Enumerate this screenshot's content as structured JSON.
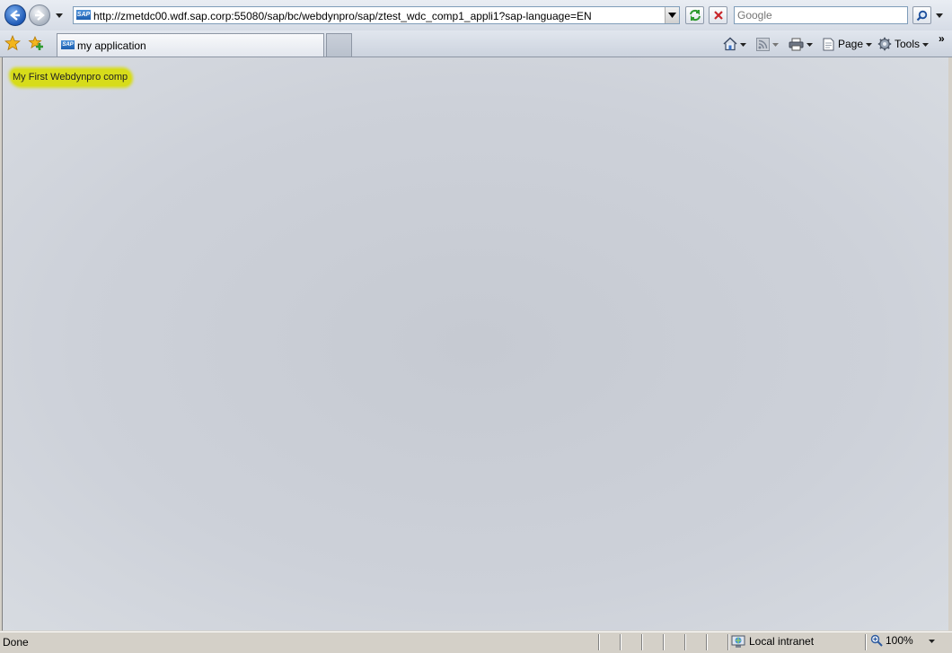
{
  "browser": {
    "address": {
      "favicon_text": "SAP",
      "url": "http://zmetdc00.wdf.sap.corp:55080/sap/bc/webdynpro/sap/ztest_wdc_comp1_appli1?sap-language=EN"
    },
    "search": {
      "placeholder": "Google"
    },
    "tab": {
      "favicon_text": "SAP",
      "title": "my application"
    },
    "commands": {
      "page_label": "Page",
      "tools_label": "Tools"
    },
    "more_chevron": "»"
  },
  "page": {
    "component_text": "My First Webdynpro comp",
    "highlight_color": "#d7dc1a"
  },
  "status_bar": {
    "status": "Done",
    "zone": "Local intranet",
    "zoom": "100%"
  },
  "icons": [
    "back-icon",
    "forward-icon",
    "refresh-icon",
    "stop-icon",
    "search-icon",
    "favorites-star-icon",
    "add-favorites-icon",
    "home-icon",
    "feeds-icon",
    "print-icon",
    "page-icon",
    "tools-gear-icon",
    "globe-icon",
    "zoom-icon"
  ]
}
